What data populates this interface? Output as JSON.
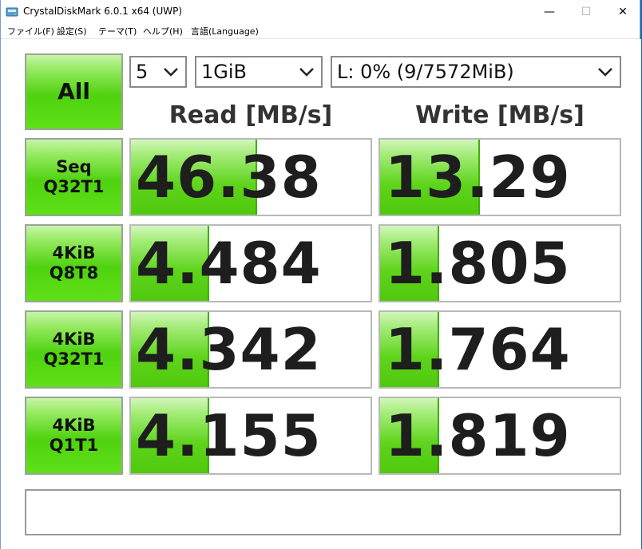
{
  "window": {
    "title": "CrystalDiskMark 6.0.1 x64 (UWP)",
    "minimize": "—",
    "maximize": "☐",
    "close": "✕"
  },
  "menu": [
    "ファイル(F)",
    "設定(S)",
    "テーマ(T)",
    "ヘルプ(H)",
    "言語(Language)"
  ],
  "controls": {
    "all_label": "All",
    "count": "5",
    "size": "1GiB",
    "drive": "L: 0% (9/7572MiB)"
  },
  "headers": {
    "read": "Read [MB/s]",
    "write": "Write [MB/s]"
  },
  "tests": [
    {
      "line1": "Seq",
      "line2": "Q32T1",
      "read": "46.38",
      "write": "13.29",
      "read_fill": 0.52,
      "write_fill": 0.41
    },
    {
      "line1": "4KiB",
      "line2": "Q8T8",
      "read": "4.484",
      "write": "1.805",
      "read_fill": 0.32,
      "write_fill": 0.24
    },
    {
      "line1": "4KiB",
      "line2": "Q32T1",
      "read": "4.342",
      "write": "1.764",
      "read_fill": 0.32,
      "write_fill": 0.24
    },
    {
      "line1": "4KiB",
      "line2": "Q1T1",
      "read": "4.155",
      "write": "1.819",
      "read_fill": 0.32,
      "write_fill": 0.24
    }
  ],
  "comment": "",
  "colors": {
    "accent_green": "#4fd20f",
    "bar_edge": "#3fae06"
  }
}
